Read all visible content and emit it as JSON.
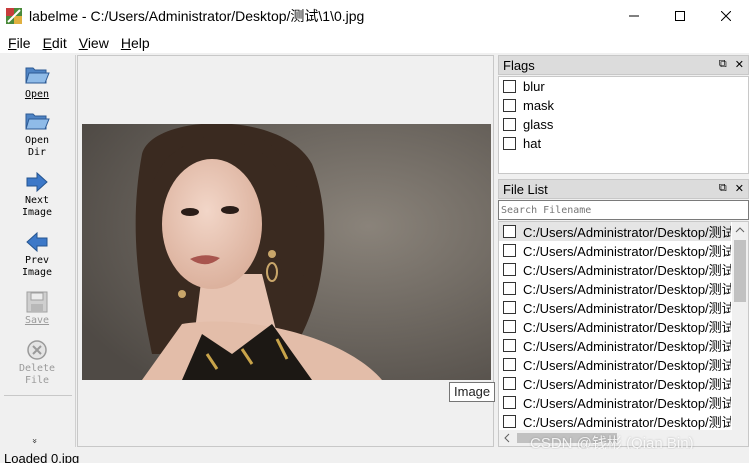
{
  "window": {
    "title": "labelme - C:/Users/Administrator/Desktop/测试\\1\\0.jpg",
    "minimize": "—",
    "maximize": "☐",
    "close": "✕"
  },
  "menu": [
    {
      "label": "File",
      "mnemonic": "F",
      "rest": "ile"
    },
    {
      "label": "Edit",
      "mnemonic": "E",
      "rest": "dit"
    },
    {
      "label": "View",
      "mnemonic": "V",
      "rest": "iew"
    },
    {
      "label": "Help",
      "mnemonic": "H",
      "rest": "elp"
    }
  ],
  "toolbar": {
    "open": {
      "l1": "Open",
      "icon": "folder-open-icon"
    },
    "open_dir": {
      "l1": "Open",
      "l2": "Dir",
      "icon": "folder-open-icon"
    },
    "next_image": {
      "l1": "Next",
      "l2": "Image",
      "icon": "arrow-right-icon"
    },
    "prev_image": {
      "l1": "Prev",
      "l2": "Image",
      "icon": "arrow-left-icon"
    },
    "save": {
      "l1": "Save",
      "icon": "save-icon"
    },
    "delete_file": {
      "l1": "Delete",
      "l2": "File",
      "icon": "delete-icon"
    },
    "more": "»"
  },
  "canvas": {
    "tooltip": "Image"
  },
  "flags": {
    "title": "Flags",
    "items": [
      "blur",
      "mask",
      "glass",
      "hat"
    ]
  },
  "file_list": {
    "title": "File List",
    "search_placeholder": "Search Filename",
    "items": [
      "C:/Users/Administrator/Desktop/测试",
      "C:/Users/Administrator/Desktop/测试",
      "C:/Users/Administrator/Desktop/测试",
      "C:/Users/Administrator/Desktop/测试",
      "C:/Users/Administrator/Desktop/测试",
      "C:/Users/Administrator/Desktop/测试",
      "C:/Users/Administrator/Desktop/测试",
      "C:/Users/Administrator/Desktop/测试",
      "C:/Users/Administrator/Desktop/测试",
      "C:/Users/Administrator/Desktop/测试",
      "C:/Users/Administrator/Desktop/测试"
    ],
    "selected_index": 0
  },
  "dock_buttons": {
    "float": "⧉",
    "close": "✕"
  },
  "watermark": "CSDN @钱彬 (Qian Bin)",
  "status": {
    "text": "Loaded 0.jpg"
  },
  "colors": {
    "accent_arrow": "#3c78c8",
    "folder": "#6fa0d8"
  }
}
